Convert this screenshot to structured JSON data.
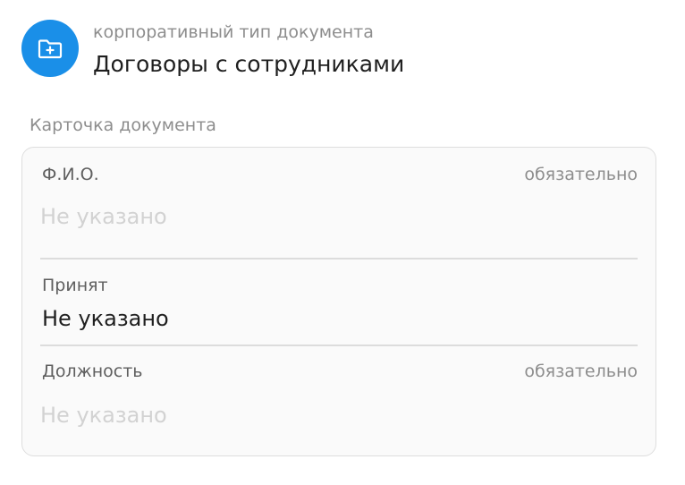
{
  "header": {
    "icon": "folder-plus-icon",
    "accent_color": "#1a8fe8",
    "kind": "корпоративный тип документа",
    "title": "Договоры с сотрудниками"
  },
  "card": {
    "label": "Карточка документа",
    "fields": [
      {
        "label": "Ф.И.О.",
        "required": "обязательно",
        "value": "Не указано",
        "is_placeholder": true
      },
      {
        "label": "Принят",
        "required": "",
        "value": "Не указано",
        "is_placeholder": false
      },
      {
        "label": "Должность",
        "required": "обязательно",
        "value": "Не указано",
        "is_placeholder": true
      }
    ]
  }
}
